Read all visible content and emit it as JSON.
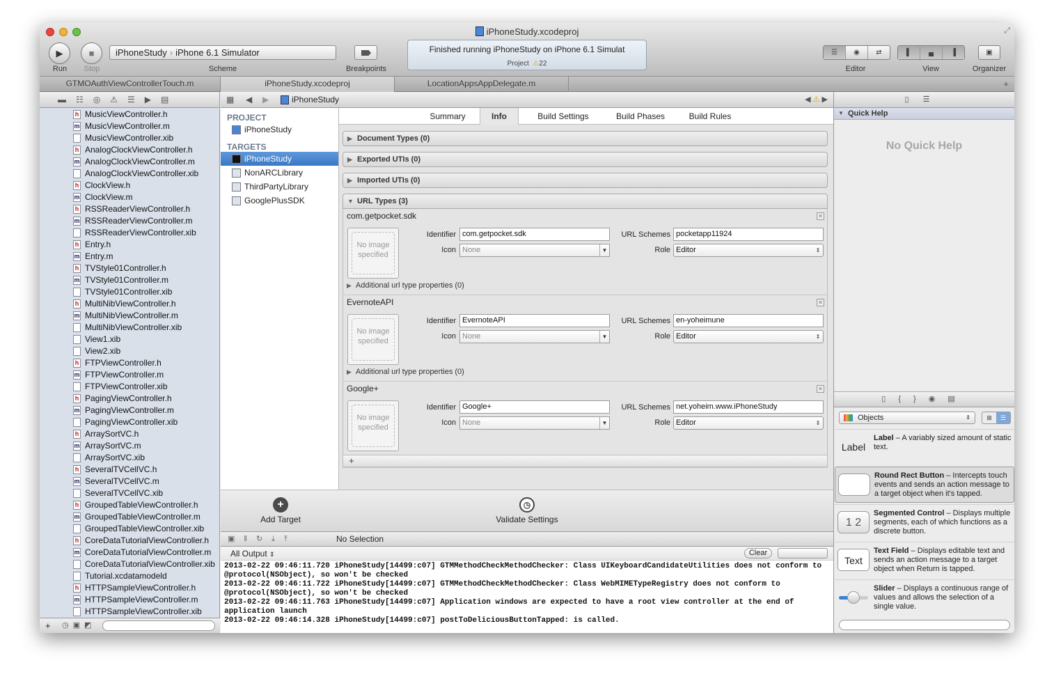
{
  "window": {
    "title": "iPhoneStudy.xcodeproj"
  },
  "toolbar": {
    "run_label": "Run",
    "stop_label": "Stop",
    "scheme_target": "iPhoneStudy",
    "scheme_destination": "iPhone 6.1 Simulator",
    "scheme_label": "Scheme",
    "breakpoints_label": "Breakpoints",
    "activity_message": "Finished running iPhoneStudy on iPhone 6.1 Simulat",
    "activity_project": "Project",
    "warning_count": "22",
    "editor_label": "Editor",
    "view_label": "View",
    "organizer_label": "Organizer"
  },
  "tabs": [
    {
      "label": "GTMOAuthViewControllerTouch.m"
    },
    {
      "label": "iPhoneStudy.xcodeproj"
    },
    {
      "label": "LocationAppsAppDelegate.m"
    }
  ],
  "navigator": {
    "files": [
      {
        "name": "MusicViewController.h",
        "type": "h"
      },
      {
        "name": "MusicViewController.m",
        "type": "m"
      },
      {
        "name": "MusicViewController.xib",
        "type": "x"
      },
      {
        "name": "AnalogClockViewController.h",
        "type": "h"
      },
      {
        "name": "AnalogClockViewController.m",
        "type": "m"
      },
      {
        "name": "AnalogClockViewController.xib",
        "type": "x"
      },
      {
        "name": "ClockView.h",
        "type": "h"
      },
      {
        "name": "ClockView.m",
        "type": "m"
      },
      {
        "name": "RSSReaderViewController.h",
        "type": "h"
      },
      {
        "name": "RSSReaderViewController.m",
        "type": "m"
      },
      {
        "name": "RSSReaderViewController.xib",
        "type": "x"
      },
      {
        "name": "Entry.h",
        "type": "h"
      },
      {
        "name": "Entry.m",
        "type": "m"
      },
      {
        "name": "TVStyle01Controller.h",
        "type": "h"
      },
      {
        "name": "TVStyle01Controller.m",
        "type": "m"
      },
      {
        "name": "TVStyle01Controller.xib",
        "type": "x"
      },
      {
        "name": "MultiNibViewController.h",
        "type": "h"
      },
      {
        "name": "MultiNibViewController.m",
        "type": "m"
      },
      {
        "name": "MultiNibViewController.xib",
        "type": "x"
      },
      {
        "name": "View1.xib",
        "type": "x"
      },
      {
        "name": "View2.xib",
        "type": "x"
      },
      {
        "name": "FTPViewController.h",
        "type": "h"
      },
      {
        "name": "FTPViewController.m",
        "type": "m"
      },
      {
        "name": "FTPViewController.xib",
        "type": "x"
      },
      {
        "name": "PagingViewController.h",
        "type": "h"
      },
      {
        "name": "PagingViewController.m",
        "type": "m"
      },
      {
        "name": "PagingViewController.xib",
        "type": "x"
      },
      {
        "name": "ArraySortVC.h",
        "type": "h"
      },
      {
        "name": "ArraySortVC.m",
        "type": "m"
      },
      {
        "name": "ArraySortVC.xib",
        "type": "x"
      },
      {
        "name": "SeveralTVCellVC.h",
        "type": "h"
      },
      {
        "name": "SeveralTVCellVC.m",
        "type": "m"
      },
      {
        "name": "SeveralTVCellVC.xib",
        "type": "x"
      },
      {
        "name": "GroupedTableViewController.h",
        "type": "h"
      },
      {
        "name": "GroupedTableViewController.m",
        "type": "m"
      },
      {
        "name": "GroupedTableViewController.xib",
        "type": "x"
      },
      {
        "name": "CoreDataTutorialViewController.h",
        "type": "h"
      },
      {
        "name": "CoreDataTutorialViewController.m",
        "type": "m"
      },
      {
        "name": "CoreDataTutorialViewController.xib",
        "type": "x"
      },
      {
        "name": "Tutorial.xcdatamodeld",
        "type": "x"
      },
      {
        "name": "HTTPSampleViewController.h",
        "type": "h"
      },
      {
        "name": "HTTPSampleViewController.m",
        "type": "m"
      },
      {
        "name": "HTTPSampleViewController.xib",
        "type": "x"
      }
    ]
  },
  "jumpbar": {
    "path": "iPhoneStudy"
  },
  "project_pane": {
    "project_header": "PROJECT",
    "project_name": "iPhoneStudy",
    "targets_header": "TARGETS",
    "targets": [
      "iPhoneStudy",
      "NonARCLibrary",
      "ThirdPartyLibrary",
      "GooglePlusSDK"
    ]
  },
  "editor": {
    "subtabs": [
      "Summary",
      "Info",
      "Build Settings",
      "Build Phases",
      "Build Rules"
    ],
    "sections": {
      "doc_types": "Document Types (0)",
      "exported_utis": "Exported UTIs (0)",
      "imported_utis": "Imported UTIs (0)",
      "url_types": "URL Types (3)"
    },
    "labels": {
      "identifier": "Identifier",
      "icon": "Icon",
      "url_schemes": "URL Schemes",
      "role": "Role",
      "no_image": "No image specified",
      "additional": "Additional url type properties (0)",
      "icon_placeholder": "None"
    },
    "url_types": [
      {
        "name": "com.getpocket.sdk",
        "identifier": "com.getpocket.sdk",
        "schemes": "pocketapp11924",
        "role": "Editor"
      },
      {
        "name": "EvernoteAPI",
        "identifier": "EvernoteAPI",
        "schemes": "en-yoheimune",
        "role": "Editor"
      },
      {
        "name": "Google+",
        "identifier": "Google+",
        "schemes": "net.yoheim.www.iPhoneStudy",
        "role": "Editor"
      }
    ]
  },
  "footer": {
    "add_target": "Add Target",
    "validate": "Validate Settings"
  },
  "debug": {
    "no_selection": "No Selection",
    "output_selector": "All Output",
    "clear": "Clear",
    "console_text": "2013-02-22 09:46:11.720 iPhoneStudy[14499:c07] GTMMethodCheckMethodChecker: Class UIKeyboardCandidateUtilities does not conform to\n@protocol(NSObject), so won't be checked\n2013-02-22 09:46:11.722 iPhoneStudy[14499:c07] GTMMethodCheckMethodChecker: Class WebMIMETypeRegistry does not conform to\n@protocol(NSObject), so won't be checked\n2013-02-22 09:46:11.763 iPhoneStudy[14499:c07] Application windows are expected to have a root view controller at the end of\napplication launch\n2013-02-22 09:46:14.328 iPhoneStudy[14499:c07] postToDeliciousButtonTapped: is called."
  },
  "utilities": {
    "quick_help_title": "Quick Help",
    "no_quick_help": "No Quick Help",
    "library_selector": "Objects",
    "objects": [
      {
        "thumb": "Label",
        "name": "Label",
        "desc": " – A variably sized amount of static text."
      },
      {
        "thumb": "",
        "name": "Round Rect Button",
        "desc": " – Intercepts touch events and sends an action message to a target object when it's tapped."
      },
      {
        "thumb": "1 2",
        "name": "Segmented Control",
        "desc": " – Displays multiple segments, each of which functions as a discrete button."
      },
      {
        "thumb": "Text",
        "name": "Text Field",
        "desc": " – Displays editable text and sends an action message to a target object when Return is tapped."
      },
      {
        "thumb": "",
        "name": "Slider",
        "desc": " – Displays a continuous range of values and allows the selection of a single value."
      }
    ]
  },
  "colors": {
    "selection": "#3a78c6",
    "sidebar": "#d9e0ea",
    "warning": "#e6b800"
  }
}
